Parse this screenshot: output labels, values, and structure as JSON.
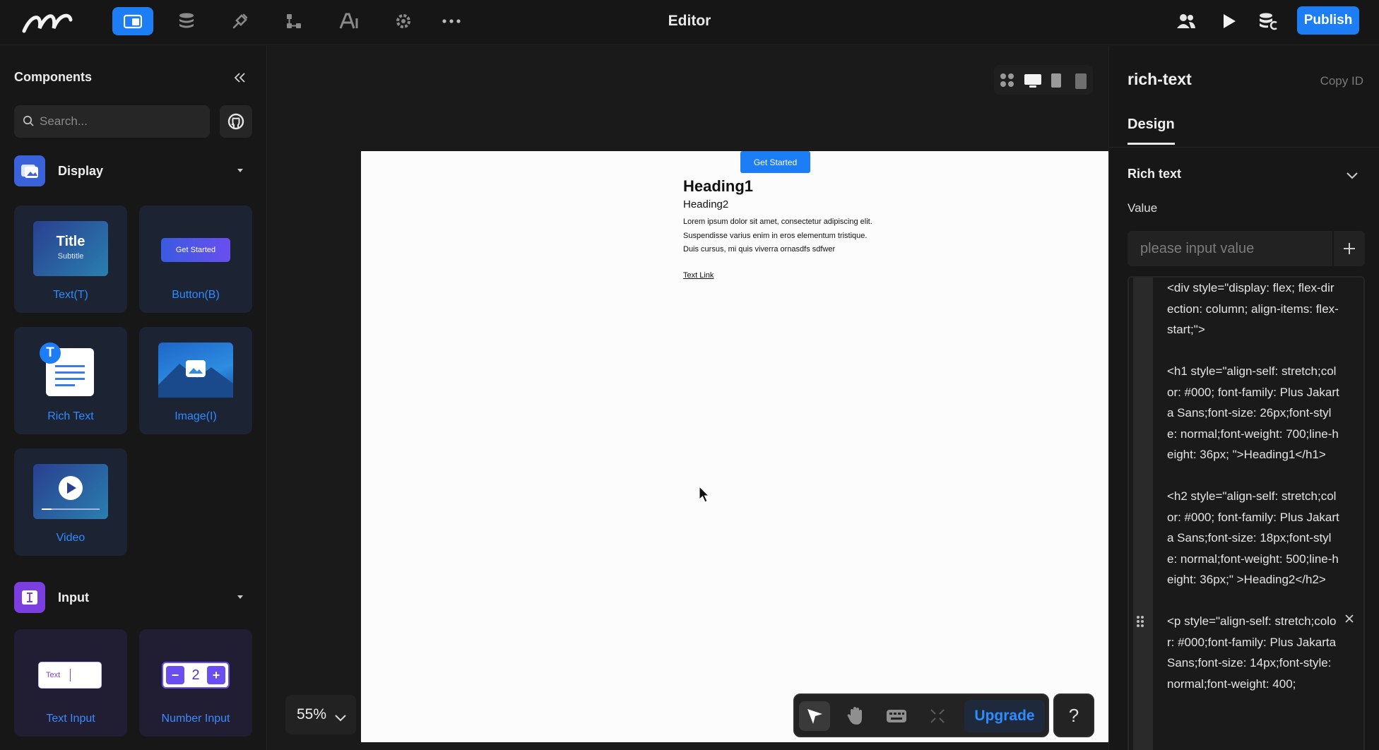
{
  "topbar": {
    "title": "Editor",
    "nav_icons": [
      "pages-icon",
      "database-icon",
      "plugin-icon",
      "flow-icon",
      "ai-icon",
      "settings-icon",
      "more-icon"
    ],
    "right_icons": [
      "users-icon",
      "play-icon",
      "cloud-publish-icon"
    ],
    "publish_label": "Publish",
    "accent_color": "#1d7df4"
  },
  "left_panel": {
    "title": "Components",
    "search_placeholder": "Search...",
    "sections": [
      {
        "label": "Display",
        "items": [
          "Text(T)",
          "Button(B)",
          "Rich Text",
          "Image(I)",
          "Video"
        ]
      },
      {
        "label": "Input",
        "items": [
          "Text Input",
          "Number Input"
        ]
      }
    ],
    "thumbs": {
      "text_title": "Title",
      "text_subtitle": "Subtitle",
      "button_text": "Get Started",
      "richtext_badge": "T",
      "textinput_text": "Text",
      "number_value": "2"
    }
  },
  "canvas": {
    "zoom": "55%",
    "page": {
      "button_label": "Get Started",
      "heading1": "Heading1",
      "heading2": "Heading2",
      "paragraph": "Lorem ipsum dolor sit amet, consectetur adipiscing elit. Suspendisse varius enim in eros elementum tristique. Duis cursus, mi quis viverra ornasdfs sdfwer",
      "text_link": "Text Link"
    },
    "toolbar": {
      "upgrade_label": "Upgrade",
      "help_label": "?"
    }
  },
  "right_panel": {
    "title": "rich-text",
    "copy_id_label": "Copy ID",
    "tab": "Design",
    "section_title": "Rich text",
    "value_label": "Value",
    "value_placeholder": "please input value",
    "code": "<div style=\"display: flex; flex-direction: column; align-items: flex-start;\">\n\n<h1 style=\"align-self: stretch;color: #000; font-family: Plus Jakarta Sans;font-size: 26px;font-style: normal;font-weight: 700;line-height: 36px; \">Heading1</h1>\n\n<h2 style=\"align-self: stretch;color: #000; font-family: Plus Jakarta Sans;font-size: 18px;font-style: normal;font-weight: 500;line-height: 36px;\" >Heading2</h2>\n\n<p style=\"align-self: stretch;color: #000;font-family: Plus Jakarta Sans;font-size: 14px;font-style: normal;font-weight: 400;"
  }
}
